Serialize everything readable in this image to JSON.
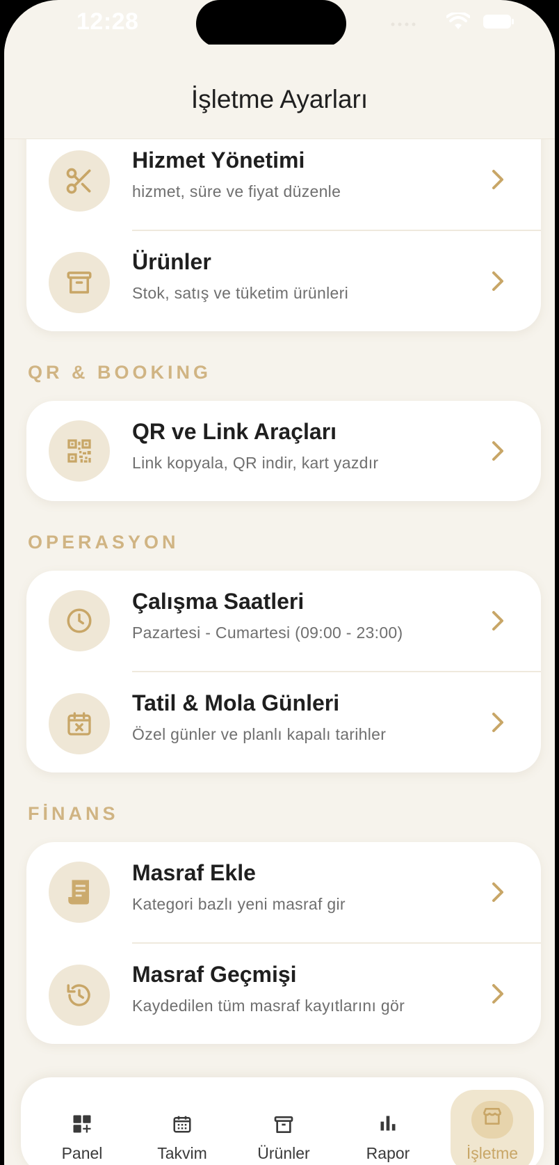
{
  "status_bar": {
    "time": "12:28"
  },
  "header": {
    "title": "İşletme Ayarları"
  },
  "top_card": {
    "items": [
      {
        "title": "Hizmet Yönetimi",
        "subtitle": "hizmet, süre ve fiyat düzenle",
        "icon": "scissors-icon"
      },
      {
        "title": "Ürünler",
        "subtitle": "Stok, satış ve tüketim ürünleri",
        "icon": "archive-box-icon"
      }
    ]
  },
  "sections": [
    {
      "label": "QR & BOOKING",
      "items": [
        {
          "title": "QR ve Link Araçları",
          "subtitle": "Link kopyala, QR indir, kart yazdır",
          "icon": "qr-code-icon"
        }
      ]
    },
    {
      "label": "OPERASYON",
      "items": [
        {
          "title": "Çalışma Saatleri",
          "subtitle": "Pazartesi - Cumartesi (09:00 - 23:00)",
          "icon": "clock-icon"
        },
        {
          "title": "Tatil & Mola Günleri",
          "subtitle": "Özel günler ve planlı kapalı tarihler",
          "icon": "calendar-x-icon"
        }
      ]
    },
    {
      "label": "FİNANS",
      "items": [
        {
          "title": "Masraf Ekle",
          "subtitle": "Kategori bazlı yeni masraf gir",
          "icon": "receipt-icon"
        },
        {
          "title": "Masraf Geçmişi",
          "subtitle": "Kaydedilen tüm masraf kayıtlarını gör",
          "icon": "history-icon"
        }
      ]
    }
  ],
  "tab_bar": {
    "tabs": [
      {
        "label": "Panel",
        "icon": "dashboard-plus-icon"
      },
      {
        "label": "Takvim",
        "icon": "calendar-icon"
      },
      {
        "label": "Ürünler",
        "icon": "archive-box-icon"
      },
      {
        "label": "Rapor",
        "icon": "bar-chart-icon"
      },
      {
        "label": "İşletme",
        "icon": "store-icon",
        "active": true
      }
    ]
  },
  "colors": {
    "background": "#F6F3EC",
    "accent": "#C8A667",
    "icon_circle": "#EFE7D6",
    "section_label": "#D0B483"
  }
}
